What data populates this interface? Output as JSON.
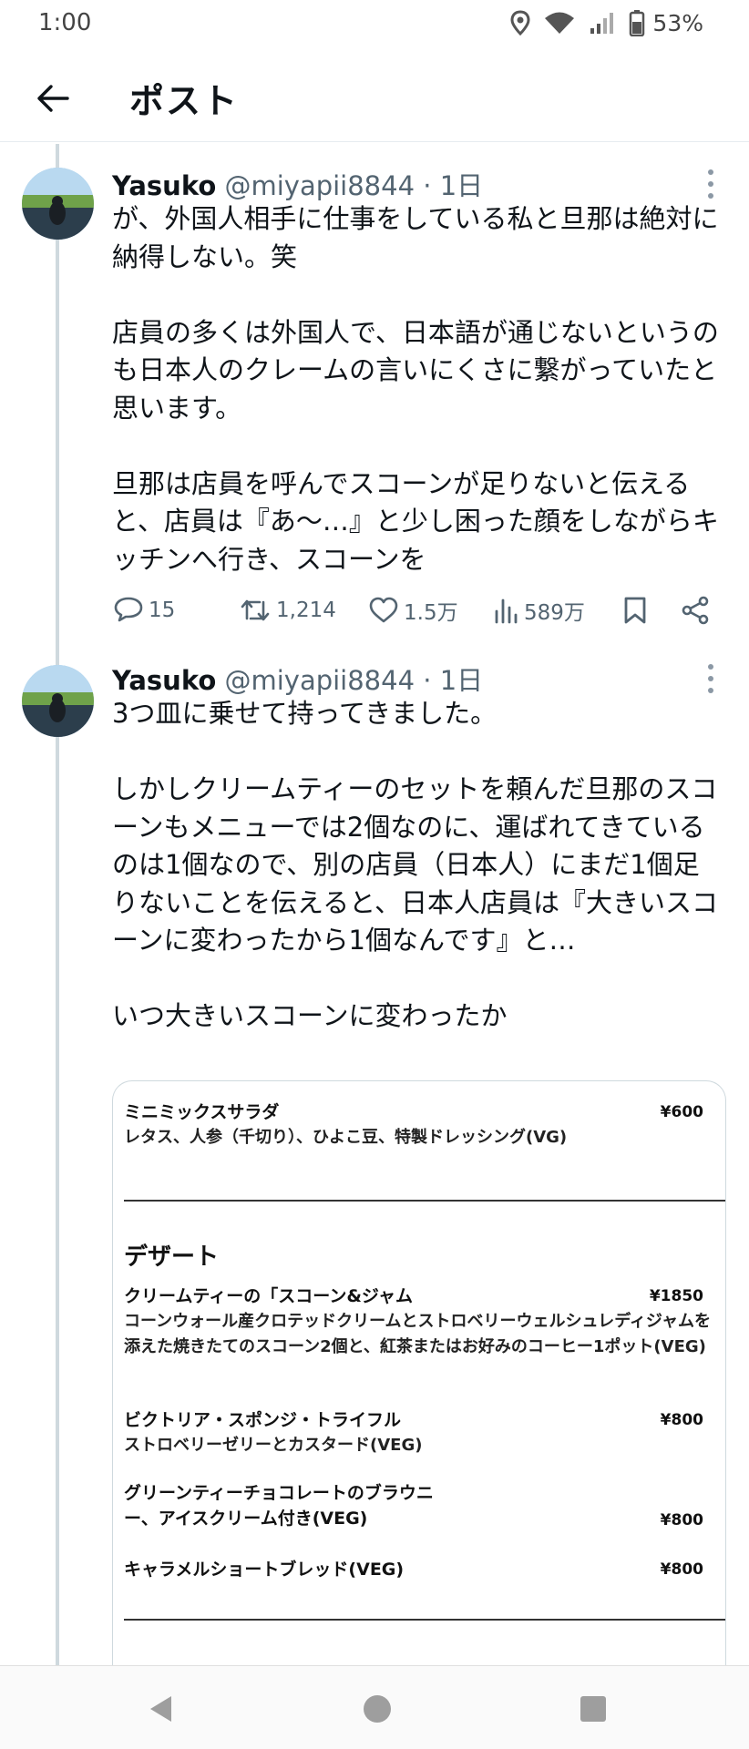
{
  "status": {
    "time": "1:00",
    "battery": "53%"
  },
  "header": {
    "title": "ポスト"
  },
  "tweets": [
    {
      "name": "Yasuko",
      "handle": "@miyapii8844 · 1日",
      "text": "が、外国人相手に仕事をしている私と旦那は絶対に納得しない。笑\n\n店員の多くは外国人で、日本語が通じないというのも日本人のクレームの言いにくさに繋がっていたと思います。\n\n旦那は店員を呼んでスコーンが足りないと伝えると、店員は『あ〜…』と少し困った顔をしながらキッチンへ行き、スコーンを",
      "replies": "15",
      "retweets": "1,214",
      "likes": "1.5万",
      "views": "589万"
    },
    {
      "name": "Yasuko",
      "handle": "@miyapii8844 · 1日",
      "text": "3つ皿に乗せて持ってきました。\n\nしかしクリームティーのセットを頼んだ旦那のスコーンもメニューでは2個なのに、運ばれてきているのは1個なので、別の店員（日本人）にまだ1個足りないことを伝えると、日本人店員は『大きいスコーンに変わったから1個なんです』と…\n\nいつ大きいスコーンに変わったか"
    }
  ],
  "menu": {
    "salad": {
      "name": "ミニミックスサラダ",
      "desc": "レタス、人参（千切り）、ひよこ豆、特製ドレッシング(VG)",
      "price": "¥600"
    },
    "section_title": "デザート",
    "items": [
      {
        "name": "クリームティーの「スコーン&ジャム",
        "desc": "コーンウォール産クロテッドクリームとストロベリーウェルシュレディジャムを添えた焼きたてのスコーン2個と、紅茶またはお好みのコーヒー1ポット(VEG)",
        "price": "¥1850"
      },
      {
        "name": "ビクトリア・スポンジ・トライフル",
        "desc": "ストロベリーゼリーとカスタード(VEG)",
        "price": "¥800"
      },
      {
        "name": "グリーンティーチョコレートのブラウニー、アイスクリーム付き(VEG)",
        "price": "¥800"
      },
      {
        "name": "キャラメルショートブレッド(VEG)",
        "price": "¥800"
      }
    ]
  },
  "colors": {
    "text": "#0f1419",
    "secondary": "#536471",
    "thread": "#cfd9de"
  }
}
